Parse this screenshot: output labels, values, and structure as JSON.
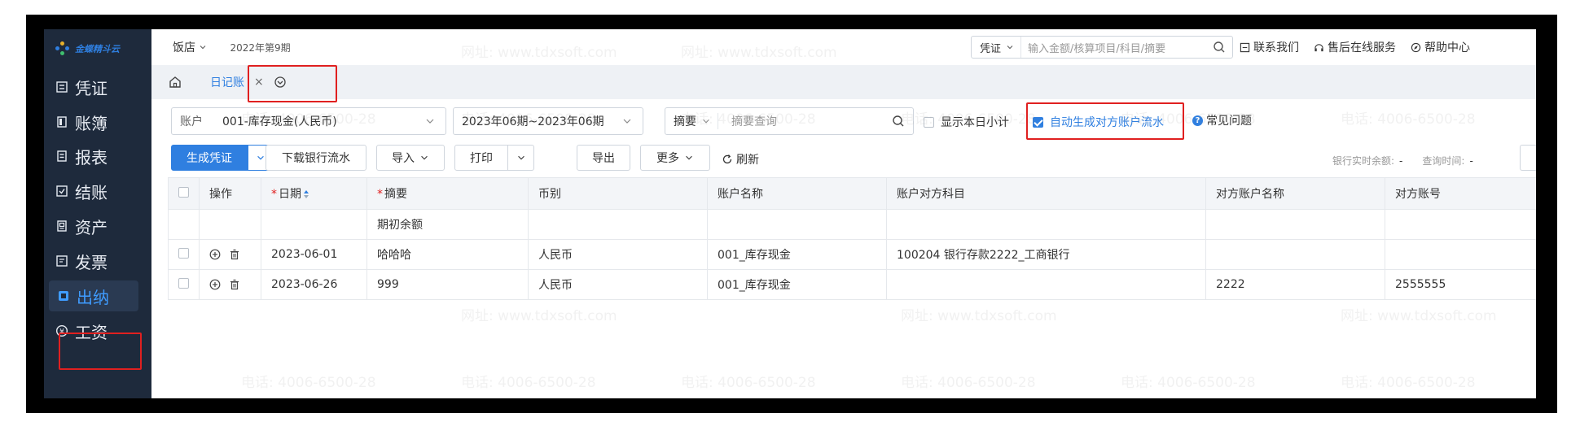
{
  "brand": {
    "name": "金蝶精斗云"
  },
  "sidebar": {
    "items": [
      {
        "label": "凭证",
        "icon": "voucher-icon",
        "active": false
      },
      {
        "label": "账簿",
        "icon": "ledger-icon",
        "active": false
      },
      {
        "label": "报表",
        "icon": "report-icon",
        "active": false
      },
      {
        "label": "结账",
        "icon": "closing-icon",
        "active": false
      },
      {
        "label": "资产",
        "icon": "asset-icon",
        "active": false
      },
      {
        "label": "发票",
        "icon": "invoice-icon",
        "active": false
      },
      {
        "label": "出纳",
        "icon": "cashier-icon",
        "active": true
      },
      {
        "label": "工资",
        "icon": "salary-icon",
        "active": false
      }
    ]
  },
  "topbar": {
    "shop": "饭店",
    "period": "2022年第9期",
    "search_type": "凭证",
    "search_placeholder": "输入金额/核算项目/科目/摘要",
    "links": {
      "contact": "联系我们",
      "service": "售后在线服务",
      "help": "帮助中心"
    }
  },
  "tabs": {
    "active_label": "日记账"
  },
  "filters": {
    "account_label": "账户",
    "account_value": "001-库存现金(人民币)",
    "period_range": "2023年06期~2023年06期",
    "summary_type": "摘要",
    "summary_placeholder": "摘要查询",
    "show_daily_subtotal": "显示本日小计",
    "show_daily_subtotal_checked": false,
    "auto_generate": "自动生成对方账户流水",
    "auto_generate_checked": true,
    "faq": "常见问题"
  },
  "toolbar": {
    "generate_voucher": "生成凭证",
    "download_bank": "下载银行流水",
    "import": "导入",
    "print": "打印",
    "export": "导出",
    "more": "更多",
    "refresh": "刷新",
    "bank_balance_label": "银行实时余额:",
    "bank_balance_value": "-",
    "query_time_label": "查询时间:",
    "query_time_value": "-"
  },
  "table": {
    "headers": {
      "ops": "操作",
      "date": "日期",
      "summary": "摘要",
      "currency": "币别",
      "account_name": "账户名称",
      "counter_subject": "账户对方科目",
      "counter_name": "对方账户名称",
      "counter_no": "对方账号"
    },
    "opening_row": {
      "summary": "期初余额"
    },
    "rows": [
      {
        "date": "2023-06-01",
        "summary": "哈哈哈",
        "currency": "人民币",
        "account_name": "001_库存现金",
        "counter_subject": "100204 银行存款2222_工商银行",
        "counter_name": "",
        "counter_no": ""
      },
      {
        "date": "2023-06-26",
        "summary": "999",
        "currency": "人民币",
        "account_name": "001_库存现金",
        "counter_subject": "",
        "counter_name": "2222",
        "counter_no": "2555555"
      }
    ]
  },
  "watermarks": {
    "phone": "电话: 4006-6500-28",
    "site": "网址: www.tdxsoft.com"
  },
  "colors": {
    "accent": "#2f7fe0",
    "sidebar": "#1e2a3c",
    "highlight": "#e02020"
  }
}
